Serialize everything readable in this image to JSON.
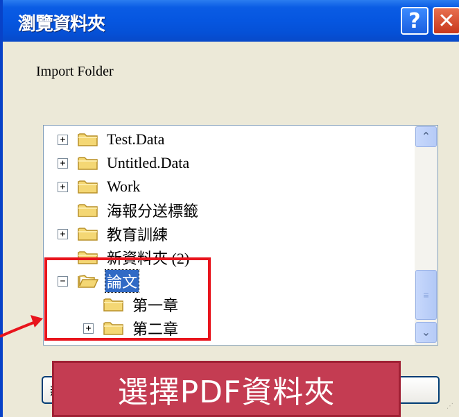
{
  "window": {
    "title": "瀏覽資料夾",
    "help_glyph": "?",
    "close_glyph": "✕"
  },
  "prompt": "Import Folder",
  "tree": {
    "items": [
      {
        "label": "Test.Data",
        "expander": "+",
        "level": 0,
        "selected": false
      },
      {
        "label": "Untitled.Data",
        "expander": "+",
        "level": 0,
        "selected": false
      },
      {
        "label": "Work",
        "expander": "+",
        "level": 0,
        "selected": false
      },
      {
        "label": "海報分送標籤",
        "expander": "",
        "level": 0,
        "selected": false
      },
      {
        "label": "教育訓練",
        "expander": "+",
        "level": 0,
        "selected": false
      },
      {
        "label": "新資料夾 (2)",
        "expander": "",
        "level": 0,
        "selected": false
      },
      {
        "label": "論文",
        "expander": "−",
        "level": 0,
        "selected": true
      },
      {
        "label": "第一章",
        "expander": "",
        "level": 1,
        "selected": false
      },
      {
        "label": "第二章",
        "expander": "+",
        "level": 1,
        "selected": false
      }
    ]
  },
  "scrollbar": {
    "up_glyph": "⌃",
    "down_glyph": "⌄",
    "thumb_glyph": "≡"
  },
  "buttons": {
    "left_partial": "新",
    "right_partial": ""
  },
  "annotation": {
    "caption": "選擇PDF資料夾",
    "highlight_color": "#e8141c",
    "banner_color": "#c43c52"
  },
  "colors": {
    "titlebar": "#0656e0",
    "selection": "#316ac5"
  }
}
